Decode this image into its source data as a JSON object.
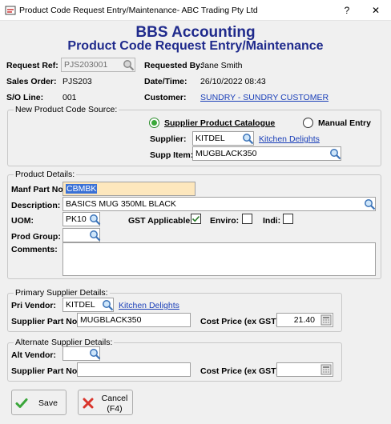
{
  "window": {
    "title": "Product Code Request Entry/Maintenance- ABC Trading Pty Ltd",
    "help_btn": "?",
    "close_btn": "✕"
  },
  "header": {
    "company": "BBS Accounting",
    "subtitle": "Product Code Request Entry/Maintenance"
  },
  "info": {
    "request_ref_label": "Request Ref:",
    "request_ref_value": "PJS203001",
    "requested_by_label": "Requested By:",
    "requested_by_value": "Jane Smith",
    "sales_order_label": "Sales Order:",
    "sales_order_value": "PJS203",
    "datetime_label": "Date/Time:",
    "datetime_value": "26/10/2022 08:43",
    "so_line_label": "S/O Line:",
    "so_line_value": "001",
    "customer_label": "Customer:",
    "customer_value": "SUNDRY - SUNDRY CUSTOMER"
  },
  "source": {
    "legend": "New Product Code Source:",
    "opt_catalogue": "Supplier Product Catalogue",
    "opt_manual": "Manual Entry",
    "selected": "catalogue",
    "supplier_label": "Supplier:",
    "supplier_code": "KITDEL",
    "supplier_name": "Kitchen Delights",
    "supp_item_label": "Supp Item:",
    "supp_item_value": "MUGBLACK350"
  },
  "product": {
    "legend": "Product Details:",
    "manf_label": "Manf Part No:",
    "manf_value": "CBMBK",
    "desc_label": "Description:",
    "desc_value": "BASICS MUG 350ML BLACK",
    "uom_label": "UOM:",
    "uom_value": "PK10",
    "gst_label": "GST Applicable:",
    "gst_checked": true,
    "enviro_label": "Enviro:",
    "enviro_checked": false,
    "indi_label": "Indi:",
    "indi_checked": false,
    "prod_group_label": "Prod Group:",
    "prod_group_value": "",
    "comments_label": "Comments:",
    "comments_value": ""
  },
  "primary": {
    "legend": "Primary Supplier Details:",
    "vendor_label": "Pri Vendor:",
    "vendor_code": "KITDEL",
    "vendor_name": "Kitchen Delights",
    "part_label": "Supplier Part No:",
    "part_value": "MUGBLACK350",
    "cost_label": "Cost Price (ex GST):",
    "cost_value": "21.40"
  },
  "alternate": {
    "legend": "Alternate Supplier Details:",
    "vendor_label": "Alt Vendor:",
    "vendor_code": "",
    "part_label": "Supplier Part No:",
    "part_value": "",
    "cost_label": "Cost Price (ex GST):",
    "cost_value": ""
  },
  "buttons": {
    "save": "Save",
    "cancel_line1": "Cancel",
    "cancel_line2": "(F4)"
  },
  "colors": {
    "heading": "#1f2a8c",
    "link": "#1a3fb8",
    "highlight_field": "#fde7bd",
    "selection": "#3a71d6",
    "save_tick": "#3aa63a",
    "cancel_cross": "#d9342b"
  }
}
